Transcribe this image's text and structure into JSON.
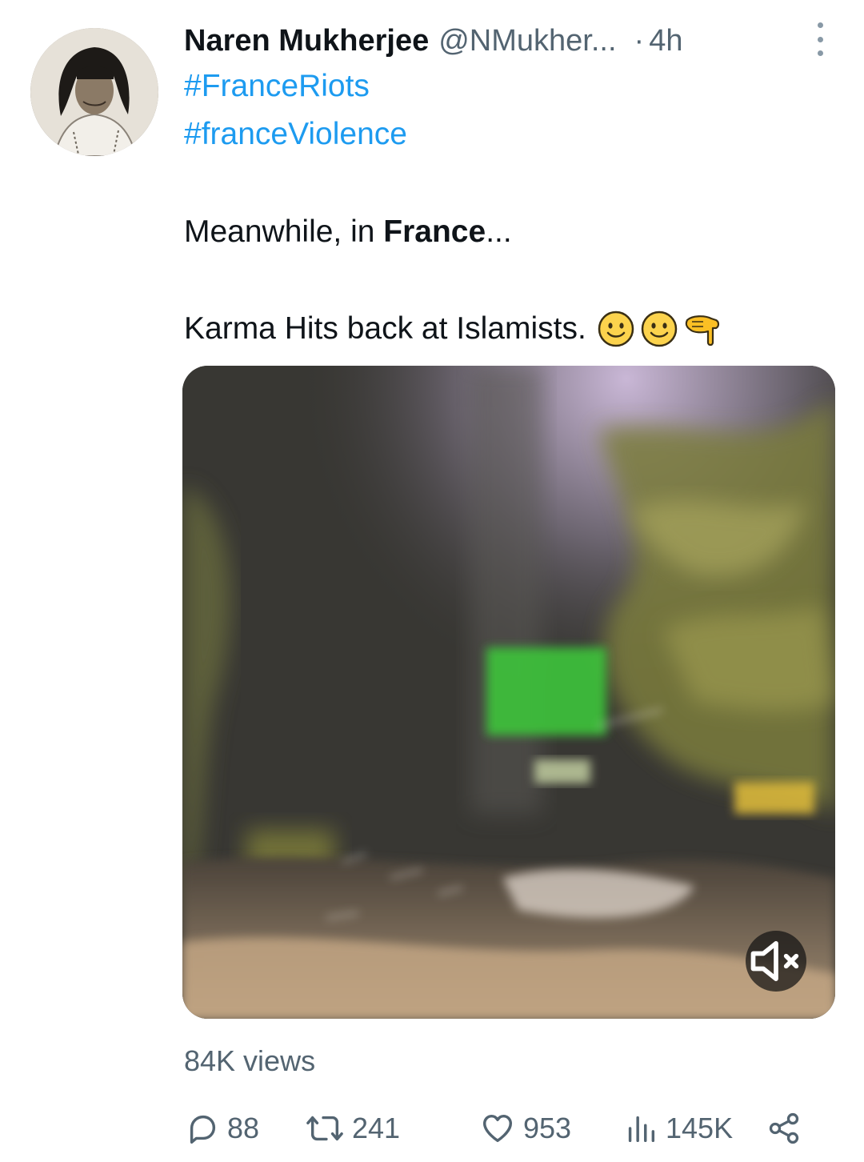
{
  "tweet": {
    "display_name": "Naren Mukherjee",
    "handle": "@NMukher...",
    "separator": "·",
    "time": "4h",
    "hashtags": [
      "#FranceRiots",
      "#franceViolence"
    ],
    "line1_prefix": "Meanwhile, in ",
    "line1_bold": "France",
    "line1_suffix": "...",
    "line2_text": "Karma Hits back at Islamists.",
    "line2_emoji_icons": [
      "slightly-smiling-face-icon",
      "slightly-smiling-face-icon",
      "backhand-index-pointing-down-icon"
    ],
    "views_label": "84K views"
  },
  "actions": {
    "replies": "88",
    "retweets": "241",
    "likes": "953",
    "analytics": "145K"
  },
  "icons": {
    "more": "more-vertical-icon",
    "mute": "speaker-muted-icon",
    "reply": "reply-icon",
    "retweet": "retweet-icon",
    "like": "heart-icon",
    "analytics": "bar-chart-icon",
    "share": "share-icon"
  },
  "colors": {
    "text": "#0f1419",
    "secondary": "#536471",
    "link": "#1d9bf0"
  }
}
